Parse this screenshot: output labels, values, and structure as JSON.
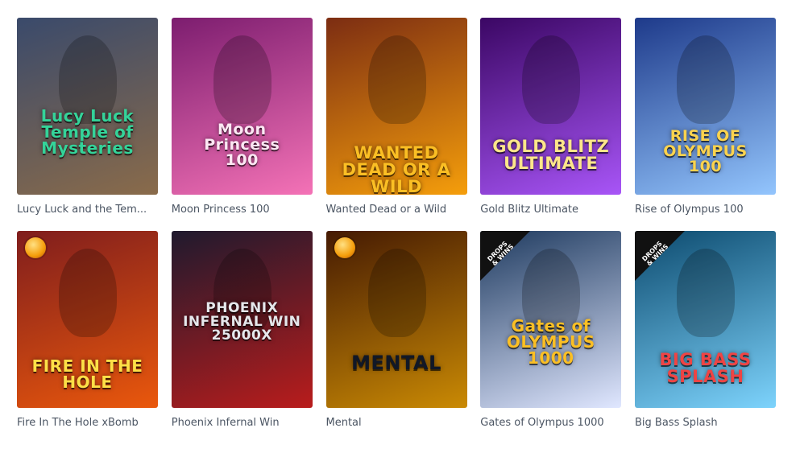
{
  "games": [
    {
      "title": "Lucy Luck and the Tem...",
      "logo": "Lucy Luck\nTemple of\nMysteries",
      "bg": [
        "#3a4a6b",
        "#8a6b4a"
      ],
      "logo_color": "#34d399",
      "badge": ""
    },
    {
      "title": "Moon Princess 100",
      "logo": "Moon\nPrincess\n100",
      "bg": [
        "#7c1d6f",
        "#f472b6"
      ],
      "logo_color": "#fce7f3",
      "badge": ""
    },
    {
      "title": "Wanted Dead or a Wild",
      "logo": "WANTED\nDEAD OR A WILD",
      "bg": [
        "#7c2d12",
        "#f59e0b"
      ],
      "logo_color": "#fbbf24",
      "badge": ""
    },
    {
      "title": "Gold Blitz Ultimate",
      "logo": "GOLD BLITZ\nULTIMATE",
      "bg": [
        "#3b0764",
        "#a855f7"
      ],
      "logo_color": "#fde68a",
      "badge": ""
    },
    {
      "title": "Rise of Olympus 100",
      "logo": "RISE OF\nOLYMPUS\n100",
      "bg": [
        "#1e3a8a",
        "#93c5fd"
      ],
      "logo_color": "#fcd34d",
      "badge": ""
    },
    {
      "title": "Fire In The Hole xBomb",
      "logo": "FIRE IN THE HOLE",
      "bg": [
        "#7f1d1d",
        "#ea580c"
      ],
      "logo_color": "#fde047",
      "badge": "coin"
    },
    {
      "title": "Phoenix Infernal Win",
      "logo": "PHOENIX\nINFERNAL WIN\n25000X",
      "bg": [
        "#1f1a2e",
        "#b91c1c"
      ],
      "logo_color": "#e5e7eb",
      "badge": ""
    },
    {
      "title": "Mental",
      "logo": "MENTAL",
      "bg": [
        "#451a03",
        "#ca8a04"
      ],
      "logo_color": "#111827",
      "badge": "coin"
    },
    {
      "title": "Gates of Olympus 1000",
      "logo": "Gates of\nOLYMPUS\n1000",
      "bg": [
        "#1e3a5f",
        "#e0e7ff"
      ],
      "logo_color": "#fbbf24",
      "badge": "drops"
    },
    {
      "title": "Big Bass Splash",
      "logo": "BIG BASS\nSPLASH",
      "bg": [
        "#0c4a6e",
        "#7dd3fc"
      ],
      "logo_color": "#ef4444",
      "badge": "drops"
    }
  ],
  "drops_label": "DROPS\n& WINS"
}
